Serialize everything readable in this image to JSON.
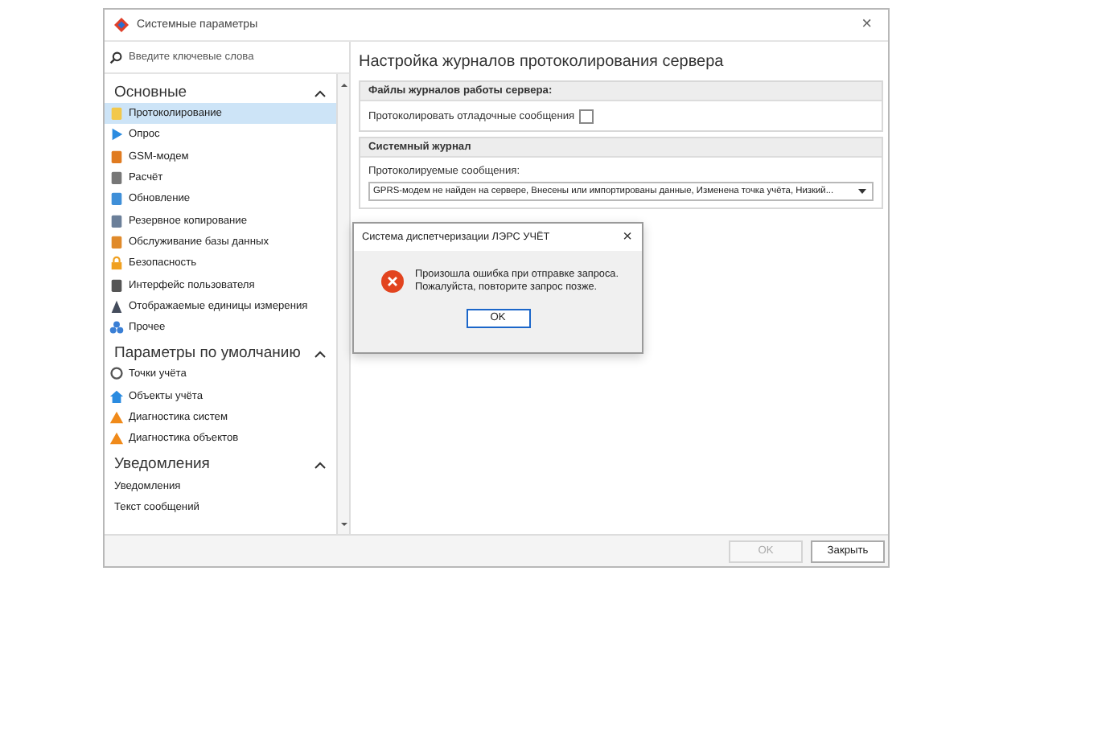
{
  "window": {
    "title": "Системные параметры",
    "close": "×"
  },
  "search": {
    "placeholder": "Введите ключевые слова"
  },
  "sidebar": {
    "sections": [
      {
        "title": "Основные",
        "expanded": true,
        "items": [
          {
            "label": "Протоколирование",
            "selected": true
          },
          {
            "label": "Опрос",
            "selected": false
          },
          {
            "label": "GSM-модем",
            "selected": false
          },
          {
            "label": "Расчёт",
            "selected": false
          },
          {
            "label": "Обновление",
            "selected": false
          },
          {
            "label": "Резервное копирование",
            "selected": false
          },
          {
            "label": "Обслуживание базы данных",
            "selected": false
          },
          {
            "label": "Безопасность",
            "selected": false
          },
          {
            "label": "Интерфейс пользователя",
            "selected": false
          },
          {
            "label": "Отображаемые единицы измерения",
            "selected": false
          },
          {
            "label": "Прочее",
            "selected": false
          }
        ]
      },
      {
        "title": "Параметры по умолчанию",
        "expanded": true,
        "items": [
          {
            "label": "Точки учёта",
            "selected": false
          },
          {
            "label": "Объекты учёта",
            "selected": false
          },
          {
            "label": "Диагностика систем",
            "selected": false
          },
          {
            "label": "Диагностика объектов",
            "selected": false
          }
        ]
      },
      {
        "title": "Уведомления",
        "expanded": true,
        "items": [
          {
            "label": "Уведомления",
            "selected": false,
            "noicon": true
          },
          {
            "label": "Текст сообщений",
            "selected": false,
            "noicon": true
          }
        ]
      }
    ]
  },
  "content": {
    "title": "Настройка журналов протоколирования сервера",
    "groups": [
      {
        "title": "Файлы журналов работы сервера:",
        "kind": "checkbox",
        "label": "Протоколировать отладочные сообщения",
        "checked": false
      },
      {
        "title": "Системный журнал",
        "kind": "dropdown",
        "label": "Протоколируемые сообщения:",
        "value": "GPRS-модем не найден на сервере, Внесены или импортированы данные, Изменена точка учёта, Низкий..."
      }
    ]
  },
  "footer": {
    "buttons": [
      {
        "label": "OK",
        "disabled": true
      },
      {
        "label": "Закрыть",
        "disabled": false
      }
    ]
  },
  "dialog": {
    "title": "Система диспетчеризации ЛЭРС УЧЁТ",
    "close": "×",
    "message": [
      "Произошла ошибка при отправке запроса.",
      "Пожалуйста, повторите запрос позже."
    ],
    "button": "OK"
  }
}
